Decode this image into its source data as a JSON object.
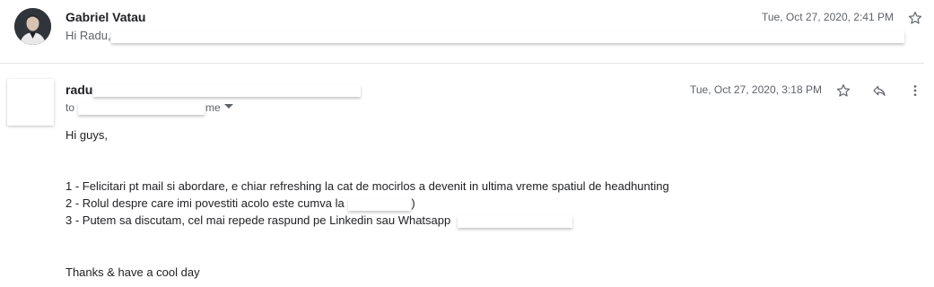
{
  "thread": {
    "first": {
      "sender": "Gabriel Vatau",
      "snippet": "Hi Radu,",
      "date": "Tue, Oct 27, 2020, 2:41 PM"
    },
    "second": {
      "sender": "radu",
      "to_prefix": "to",
      "to_suffix": "me",
      "date": "Tue, Oct 27, 2020, 3:18 PM",
      "body": {
        "greeting": "Hi guys,",
        "line1": "1 - Felicitari pt mail si abordare, e chiar refreshing la cat de mocirlos a devenit in ultima vreme spatiul de headhunting",
        "line2_a": "2 - Rolul despre care imi povestiti acolo este cumva la",
        "line2_b": ":)",
        "line3": "3 - Putem sa discutam, cel mai repede raspund pe Linkedin sau Whatsapp",
        "signoff": "Thanks & have a cool day"
      }
    }
  },
  "icons": {
    "star": "star-outline-icon",
    "reply": "reply-icon",
    "more": "more-vert-icon",
    "dropdown": "caret-down-icon"
  },
  "colors": {
    "text": "#202124",
    "muted": "#5f6368",
    "divider": "#e3e3e3"
  }
}
